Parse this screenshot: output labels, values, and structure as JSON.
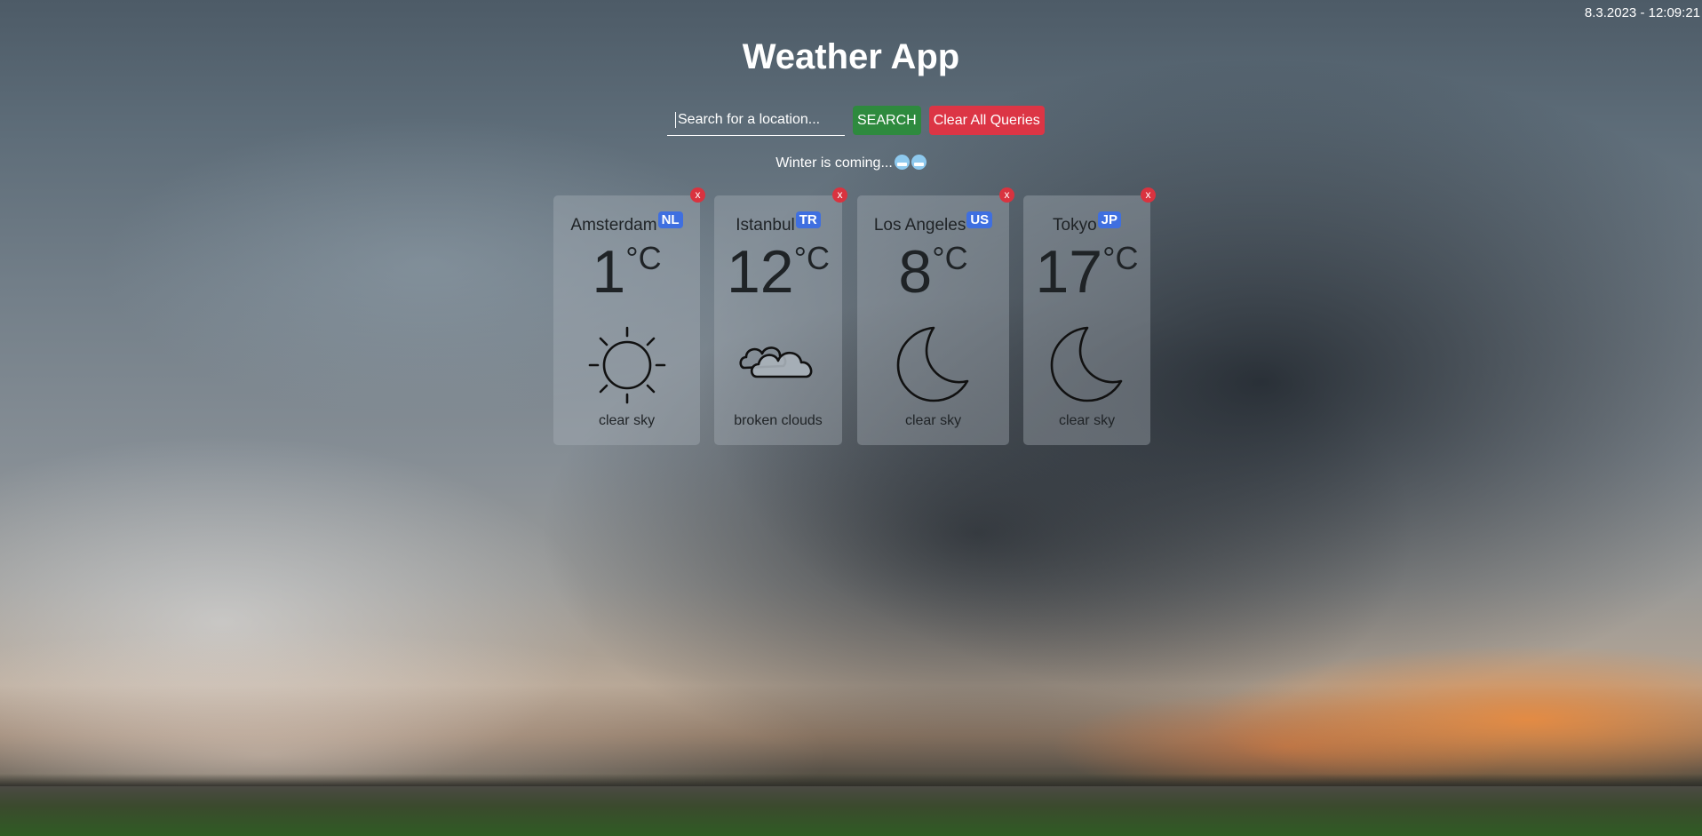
{
  "clock": "8.3.2023 - 12:09:21",
  "title": "Weather App",
  "search": {
    "placeholder": "Search for a location...",
    "search_label": "SEARCH",
    "clear_label": "Clear All Queries"
  },
  "tagline": "Winter is coming...",
  "tagline_emoji": "cold-face-emoji",
  "cards": [
    {
      "city": "Amsterdam",
      "country": "NL",
      "temp": "1",
      "unit": "°C",
      "icon": "sun-icon",
      "description": "clear sky",
      "close": "x"
    },
    {
      "city": "Istanbul",
      "country": "TR",
      "temp": "12",
      "unit": "°C",
      "icon": "clouds-icon",
      "description": "broken clouds",
      "close": "x"
    },
    {
      "city": "Los Angeles",
      "country": "US",
      "temp": "8",
      "unit": "°C",
      "icon": "moon-icon",
      "description": "clear sky",
      "close": "x"
    },
    {
      "city": "Tokyo",
      "country": "JP",
      "temp": "17",
      "unit": "°C",
      "icon": "moon-icon",
      "description": "clear sky",
      "close": "x"
    }
  ],
  "colors": {
    "search_button": "#2e8a3e",
    "clear_button": "#dc3545",
    "badge": "#3f6fe0",
    "close_button": "#d9333f"
  }
}
